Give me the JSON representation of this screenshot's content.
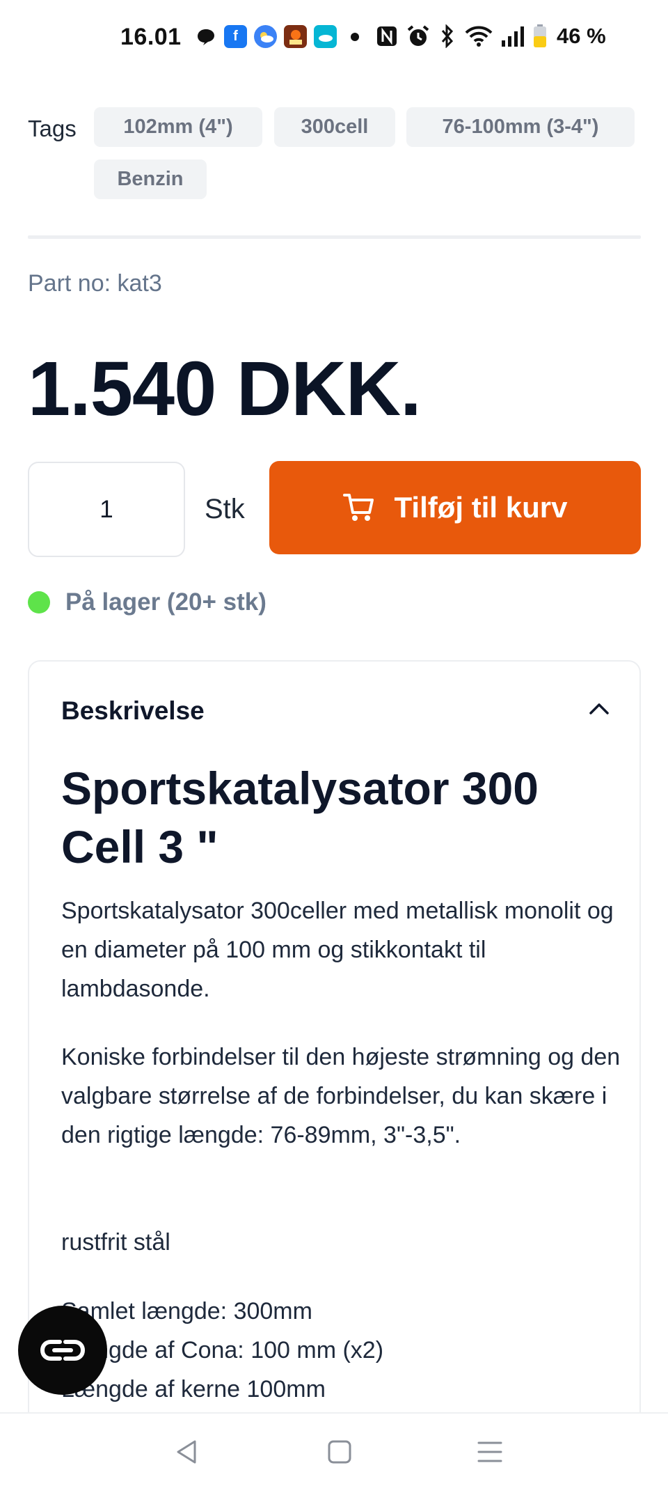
{
  "status_bar": {
    "time": "16.01",
    "battery": "46 %",
    "app_icons": [
      "speech-bubble-icon",
      "facebook-icon",
      "weather-icon",
      "photo-app-icon",
      "cloud-app-icon",
      "dot-icon"
    ],
    "system_icons": [
      "nfc-icon",
      "alarm-icon",
      "bluetooth-icon",
      "wifi-icon",
      "signal-icon",
      "battery-icon"
    ]
  },
  "tags": {
    "label": "Tags",
    "items": [
      "102mm (4\")",
      "300cell",
      "76-100mm (3-4\")",
      "Benzin"
    ]
  },
  "product": {
    "part_no": "Part no: kat3",
    "price": "1.540 DKK.",
    "quantity": "1",
    "unit": "Stk",
    "add_to_cart_label": "Tilføj til kurv",
    "stock_text": "På lager (20+ stk)"
  },
  "description": {
    "header": "Beskrivelse",
    "title": "Sportskatalysator 300 Cell 3 \"",
    "paragraphs": [
      "Sportskatalysator 300celler med metallisk monolit og en diameter på 100 mm og stikkontakt til lambdasonde.",
      "Koniske forbindelser til den højeste strømning og den valgbare størrelse af de forbindelser, du kan skære i den rigtige længde: 76-89mm, 3\"-3,5\".",
      "rustfrit stål"
    ],
    "specs": [
      "Samlet længde: 300mm",
      "Længde af Cona: 100 mm (x2)",
      "Længde af kerne 100mm"
    ]
  },
  "colors": {
    "accent": "#e8590c",
    "stock_dot": "#5ee34a",
    "price": "#0b1426"
  }
}
